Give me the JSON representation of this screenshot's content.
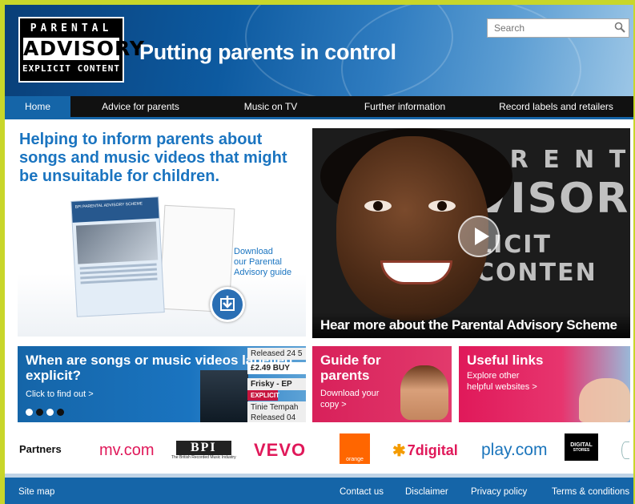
{
  "header": {
    "logo": {
      "line1": "PARENTAL",
      "line2": "ADVISORY",
      "line3": "EXPLICIT CONTENT"
    },
    "tagline": "Putting parents in control",
    "search": {
      "placeholder": "Search",
      "icon": "search-icon"
    }
  },
  "nav": {
    "items": [
      {
        "label": "Home",
        "active": true
      },
      {
        "label": "Advice for parents",
        "active": false
      },
      {
        "label": "Music on TV",
        "active": false
      },
      {
        "label": "Further information",
        "active": false
      },
      {
        "label": "Record labels and retailers",
        "active": false
      }
    ]
  },
  "hero": {
    "title": "Helping to inform parents about songs and music videos that might be unsuitable for children.",
    "guide_header": "BPI PARENTAL ADVISORY SCHEME",
    "download": {
      "line1": "Download",
      "line2": "our Parental",
      "line3": "Advisory guide",
      "icon": "download-icon"
    }
  },
  "video": {
    "caption": "Hear more about the Parental Advisory Scheme",
    "backdrop": {
      "l1": "A R E N T A",
      "l2": "VISOR",
      "l3": "LICIT CONTEN"
    },
    "icon": "play-icon"
  },
  "promos": {
    "explicit": {
      "title": "When are songs or music videos labelled explicit?",
      "cta": "Click to find out >",
      "release1": "Released 24 5",
      "price": "£2.49  BUY",
      "track": "Frisky - EP",
      "badge": "EXPLICIT",
      "artist": "Tinie Tempah",
      "release2": "Released 04"
    },
    "guide": {
      "title": "Guide for parents",
      "line1": "Download your",
      "line2": "copy >"
    },
    "links": {
      "title": "Useful links",
      "line1": "Explore other",
      "line2": "helpful websites >"
    }
  },
  "partners": {
    "label": "Partners",
    "logos": [
      {
        "name": "mv.com",
        "text": "mv.com"
      },
      {
        "name": "BPI",
        "text": "BPI",
        "sub": "The British Recorded Music Industry"
      },
      {
        "name": "VEVO",
        "text": "VEVO"
      },
      {
        "name": "orange",
        "text": "orange"
      },
      {
        "name": "7digital",
        "text": "7digital"
      },
      {
        "name": "play.com",
        "text": "play.com"
      },
      {
        "name": "Digital Stores",
        "text": "DIGITAL",
        "sub": "STORES"
      }
    ]
  },
  "footer": {
    "sitemap": "Site map",
    "links": [
      "Contact us",
      "Disclaimer",
      "Privacy policy",
      "Terms & conditions"
    ]
  },
  "colors": {
    "frame": "#c8d62a",
    "brand_blue": "#1565a8",
    "accent_pink": "#d8205a",
    "nav_bg": "#111111"
  }
}
